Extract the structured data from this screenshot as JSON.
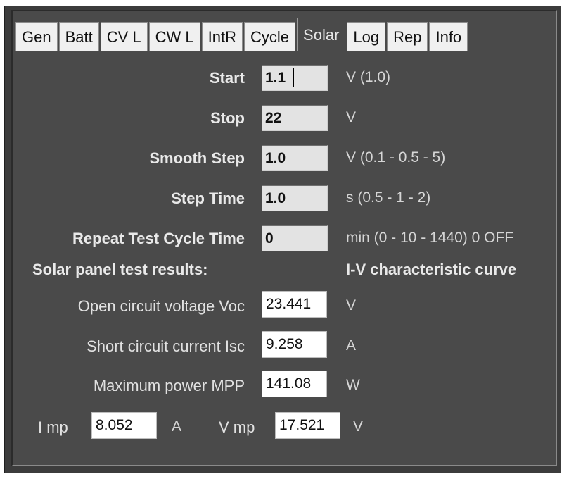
{
  "tabs": [
    {
      "label": "Gen"
    },
    {
      "label": "Batt"
    },
    {
      "label": "CV L"
    },
    {
      "label": "CW L"
    },
    {
      "label": "IntR"
    },
    {
      "label": "Cycle"
    },
    {
      "label": "Solar"
    },
    {
      "label": "Log"
    },
    {
      "label": "Rep"
    },
    {
      "label": "Info"
    }
  ],
  "active_tab": "Solar",
  "settings": {
    "start": {
      "label": "Start",
      "value": "1.1",
      "unit": "V (1.0)"
    },
    "stop": {
      "label": "Stop",
      "value": "22",
      "unit": "V"
    },
    "smooth_step": {
      "label": "Smooth Step",
      "value": "1.0",
      "unit": "V (0.1 - 0.5 - 5)"
    },
    "step_time": {
      "label": "Step Time",
      "value": "1.0",
      "unit": "s (0.5 - 1 - 2)"
    },
    "repeat": {
      "label": "Repeat Test Cycle Time",
      "value": "0",
      "unit": "min (0 - 10 - 1440) 0 OFF"
    }
  },
  "results_heading": "Solar panel test results:",
  "curve_heading": "I-V characteristic curve",
  "results": {
    "voc": {
      "label": "Open circuit voltage Voc",
      "value": "23.441",
      "unit": "V"
    },
    "isc": {
      "label": "Short circuit current Isc",
      "value": "9.258",
      "unit": "A"
    },
    "mpp": {
      "label": "Maximum power MPP",
      "value": "141.08",
      "unit": "W"
    }
  },
  "mp": {
    "imp_label": "I mp",
    "imp_value": "8.052",
    "imp_unit": "A",
    "vmp_label": "V mp",
    "vmp_value": "17.521",
    "vmp_unit": "V"
  }
}
